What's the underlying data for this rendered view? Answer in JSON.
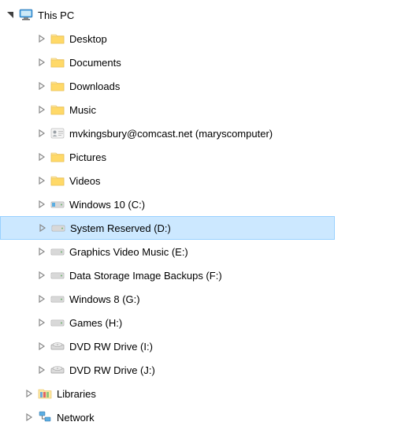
{
  "tree": {
    "this_pc": {
      "label": "This PC",
      "expanded": true
    },
    "items": [
      {
        "label": "Desktop",
        "icon": "folder",
        "expanded": false,
        "selected": false
      },
      {
        "label": "Documents",
        "icon": "folder",
        "expanded": false,
        "selected": false
      },
      {
        "label": "Downloads",
        "icon": "folder",
        "expanded": false,
        "selected": false
      },
      {
        "label": "Music",
        "icon": "folder",
        "expanded": false,
        "selected": false
      },
      {
        "label": "mvkingsbury@comcast.net (maryscomputer)",
        "icon": "contact",
        "expanded": false,
        "selected": false
      },
      {
        "label": "Pictures",
        "icon": "folder",
        "expanded": false,
        "selected": false
      },
      {
        "label": "Videos",
        "icon": "folder",
        "expanded": false,
        "selected": false
      },
      {
        "label": "Windows 10 (C:)",
        "icon": "drive-win",
        "expanded": false,
        "selected": false
      },
      {
        "label": "System Reserved (D:)",
        "icon": "drive",
        "expanded": false,
        "selected": true
      },
      {
        "label": "Graphics Video Music (E:)",
        "icon": "drive",
        "expanded": false,
        "selected": false
      },
      {
        "label": "Data Storage Image Backups (F:)",
        "icon": "drive",
        "expanded": false,
        "selected": false
      },
      {
        "label": "Windows 8 (G:)",
        "icon": "drive",
        "expanded": false,
        "selected": false
      },
      {
        "label": "Games (H:)",
        "icon": "drive",
        "expanded": false,
        "selected": false
      },
      {
        "label": "DVD RW Drive (I:)",
        "icon": "dvd",
        "expanded": false,
        "selected": false
      },
      {
        "label": "DVD RW Drive (J:)",
        "icon": "dvd",
        "expanded": false,
        "selected": false
      }
    ],
    "libraries": {
      "label": "Libraries",
      "expanded": false
    },
    "network": {
      "label": "Network",
      "expanded": false
    }
  }
}
